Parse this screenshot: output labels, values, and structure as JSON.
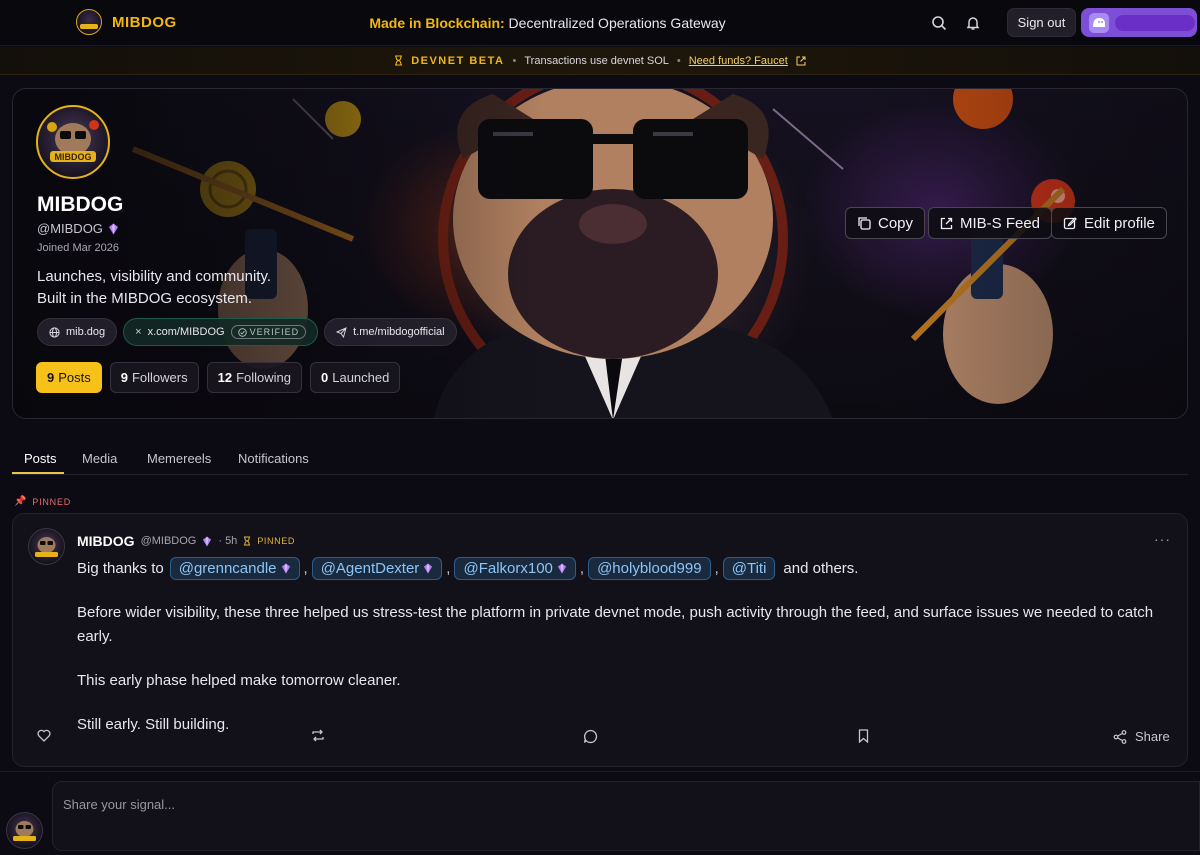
{
  "app": {
    "brand_name": "MIBDOG",
    "tagline_highlight": "Made in Blockchain:",
    "tagline_rest": " Decentralized Operations Gateway",
    "sign_out_label": "Sign out",
    "accent_color": "#f2b70f",
    "wallet_color": "#7d4ed6"
  },
  "devnet": {
    "beta_label": "DEVNET BETA",
    "message": "Transactions use devnet SOL",
    "faucet_link": "Need funds? Faucet"
  },
  "profile": {
    "avatar_text": "MIBDOG",
    "name": "MIBDOG",
    "handle": "@MIBDOG",
    "joined": "Joined Mar 2026",
    "bio_line1": "Launches, visibility and community.",
    "bio_line2": "Built in the MIBDOG ecosystem.",
    "links": [
      {
        "label": "mib.dog",
        "icon": "globe-icon"
      },
      {
        "label": "x.com/MIBDOG",
        "icon": "x-icon",
        "badge": "VERIFIED"
      },
      {
        "label": "t.me/mibdogofficial",
        "icon": "telegram-icon"
      }
    ],
    "stats": [
      {
        "count": "9",
        "label": "Posts",
        "active": true
      },
      {
        "count": "9",
        "label": "Followers"
      },
      {
        "count": "12",
        "label": "Following"
      },
      {
        "count": "0",
        "label": "Launched"
      }
    ],
    "actions": {
      "copy": "Copy",
      "feed": "MIB-S Feed",
      "edit": "Edit profile"
    }
  },
  "tabs": [
    {
      "label": "Posts",
      "active": true
    },
    {
      "label": "Media"
    },
    {
      "label": "Memereels"
    },
    {
      "label": "Notifications"
    }
  ],
  "pinned_label": "PINNED",
  "post": {
    "author": "MIBDOG",
    "handle": "@MIBDOG",
    "time": "· 5h",
    "pinned_badge": "PINNED",
    "intro": "Big thanks to",
    "mentions": [
      {
        "label": "@grenncandle",
        "verified": true
      },
      {
        "label": "@AgentDexter",
        "verified": true
      },
      {
        "label": "@Falkorx100",
        "verified": true
      },
      {
        "label": "@holyblood999",
        "verified": false
      },
      {
        "label": "@Titi",
        "verified": false
      }
    ],
    "outro": "and others.",
    "paragraphs": [
      "Before wider visibility, these three helped us stress-test the platform in private devnet mode, push activity through the feed, and surface issues we needed to catch early.",
      "This early phase helped make tomorrow cleaner.",
      "Still early. Still building."
    ],
    "share_label": "Share"
  },
  "composer": {
    "placeholder": "Share your signal..."
  }
}
